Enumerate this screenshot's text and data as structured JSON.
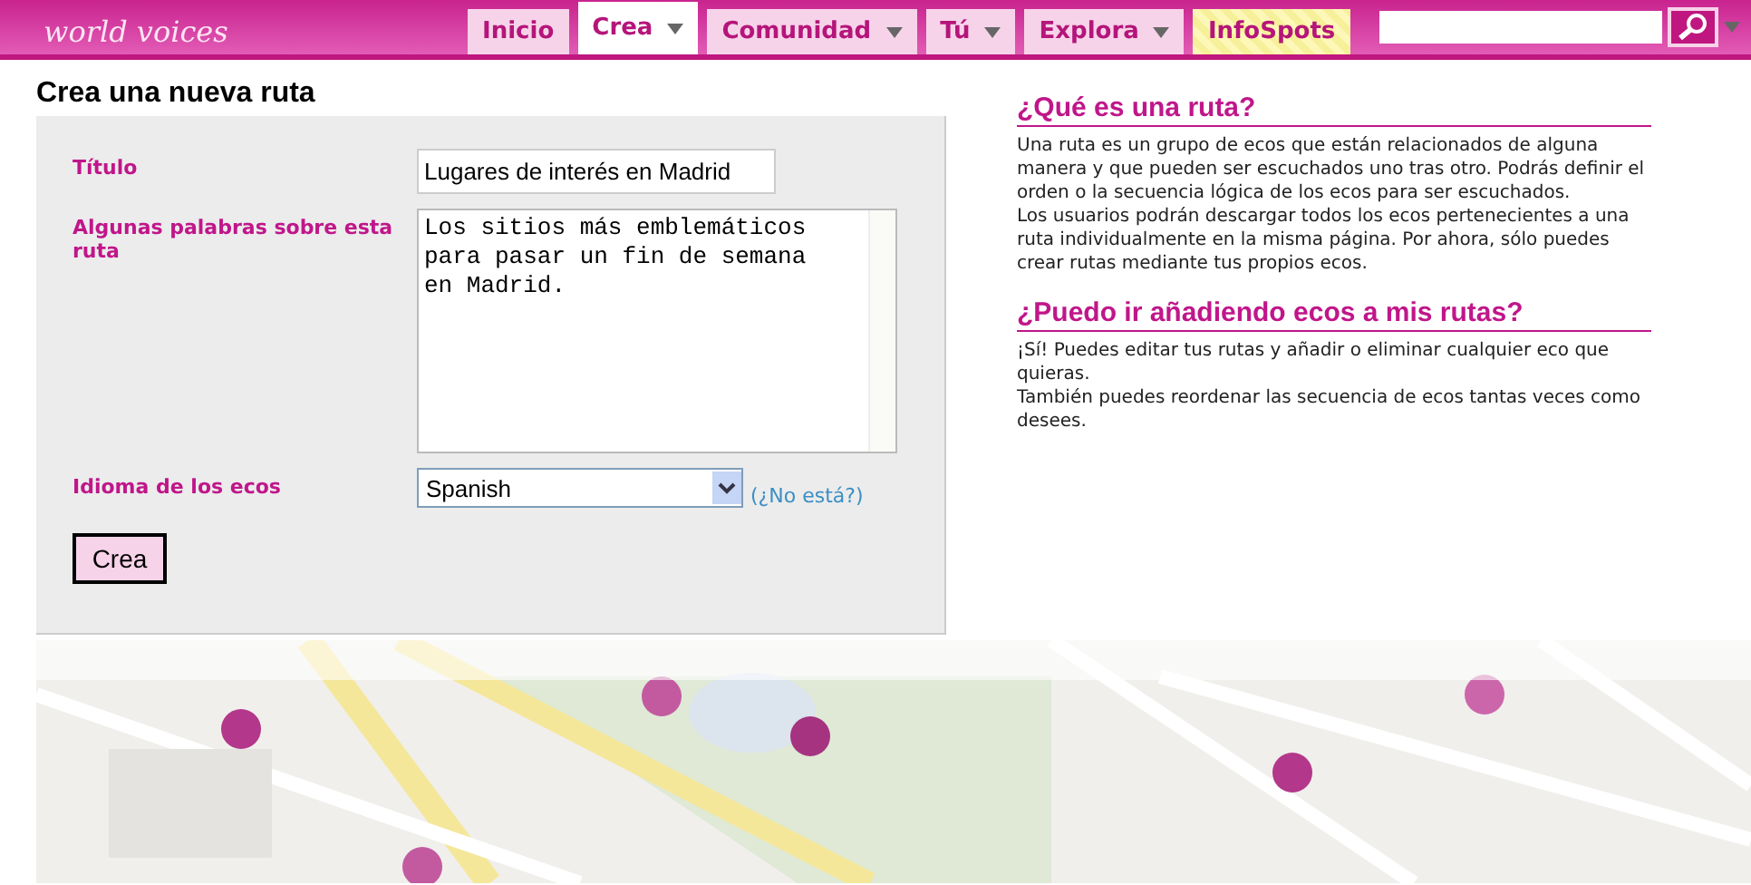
{
  "header": {
    "logo_tagline": "world voices",
    "nav": [
      {
        "label": "Inicio",
        "selected": false,
        "dropdown": false,
        "kind": "normal"
      },
      {
        "label": "Crea",
        "selected": true,
        "dropdown": true,
        "kind": "normal"
      },
      {
        "label": "Comunidad",
        "selected": false,
        "dropdown": true,
        "kind": "normal"
      },
      {
        "label": "Tú",
        "selected": false,
        "dropdown": true,
        "kind": "normal"
      },
      {
        "label": "Explora",
        "selected": false,
        "dropdown": true,
        "kind": "normal"
      },
      {
        "label": "InfoSpots",
        "selected": false,
        "dropdown": false,
        "kind": "highlight"
      }
    ]
  },
  "page_title": "Crea una nueva ruta",
  "form": {
    "fields": [
      {
        "kind": "text",
        "label": "Título",
        "value": "Lugares de interés en Madrid"
      },
      {
        "kind": "textarea",
        "label": "Algunas palabras sobre esta ruta",
        "value": "Los sitios más emblemáticos para pasar un fin de semana en Madrid."
      },
      {
        "kind": "select",
        "label": "Idioma de los ecos",
        "value": "Spanish",
        "link": "(¿No está?)"
      }
    ],
    "submit": "Crea"
  },
  "help": [
    {
      "heading": "¿Qué es una ruta?",
      "paragraphs": [
        "Una ruta es un grupo de ecos que están relacionados de alguna manera y que pueden ser escuchados uno tras otro. Podrás definir el orden o la secuencia lógica de los ecos para ser escuchados.",
        "Los usuarios podrán descargar todos los ecos pertenecientes a una ruta individualmente en la misma página. Por ahora, sólo puedes crear rutas mediante tus propios ecos."
      ]
    },
    {
      "heading": "¿Puedo ir añadiendo ecos a mis rutas?",
      "paragraphs": [
        "¡Sí! Puedes editar tus rutas y añadir o eliminar cualquier eco que quieras.",
        "También puedes reordenar las secuencia de ecos tantas veces como desees."
      ]
    }
  ]
}
